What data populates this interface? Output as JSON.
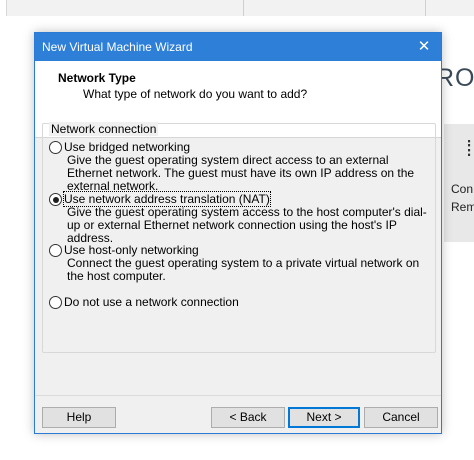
{
  "background": {
    "partial_heading": "RO",
    "partial_text_1": "Con",
    "partial_text_2": "Rem"
  },
  "dialog": {
    "title": "New Virtual Machine Wizard",
    "close_glyph": "✕",
    "header_title": "Network Type",
    "header_subtitle": "What type of network do you want to add?"
  },
  "network_group": {
    "label": "Network connection",
    "options": [
      {
        "label": "Use bridged networking",
        "description": "Give the guest operating system direct access to an external Ethernet network. The guest must have its own IP address on the external network.",
        "selected": false
      },
      {
        "label": "Use network address translation (NAT)",
        "description": "Give the guest operating system access to the host computer's dial-up or external Ethernet network connection using the host's IP address.",
        "selected": true
      },
      {
        "label": "Use host-only networking",
        "description": "Connect the guest operating system to a private virtual network on the host computer.",
        "selected": false
      },
      {
        "label": "Do not use a network connection",
        "description": "",
        "selected": false
      }
    ]
  },
  "buttons": {
    "help": "Help",
    "back": "< Back",
    "next": "Next >",
    "cancel": "Cancel"
  },
  "colors": {
    "titlebar": "#2d7fd8",
    "dialog_bg": "#f0f0f0",
    "default_button_border": "#0078d7"
  }
}
